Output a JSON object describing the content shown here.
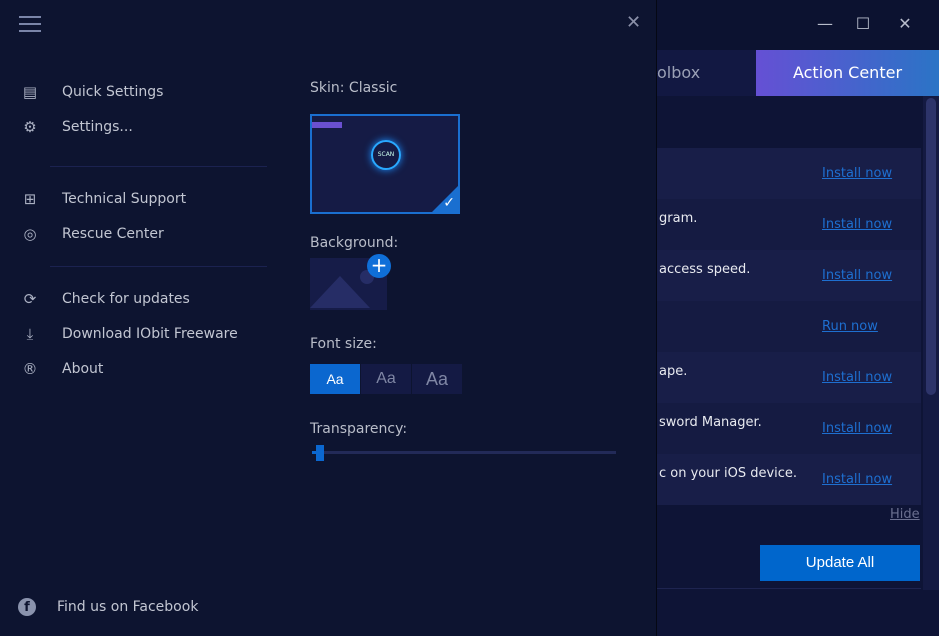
{
  "background_window": {
    "tabs": [
      {
        "label": "olbox"
      },
      {
        "label": "Action Center",
        "active": true
      }
    ],
    "rows": [
      {
        "text": "",
        "action": "Install now"
      },
      {
        "text": "gram.",
        "action": "Install now"
      },
      {
        "text": "access speed.",
        "action": "Install now"
      },
      {
        "text": "",
        "action": "Run now"
      },
      {
        "text": "ape.",
        "action": "Install now"
      },
      {
        "text": "sword Manager.",
        "action": "Install now"
      },
      {
        "text": "c on your iOS device.",
        "action": "Install now"
      }
    ],
    "hide_label": "Hide",
    "update_all_label": "Update All",
    "window_controls": {
      "minimize": "—",
      "maximize": "☐",
      "close": "✕"
    }
  },
  "menu": {
    "close_glyph": "✕",
    "groups": [
      [
        {
          "label": "Quick Settings",
          "icon": "toggle-icon"
        },
        {
          "label": "Settings...",
          "icon": "gear-icon"
        }
      ],
      [
        {
          "label": "Technical Support",
          "icon": "support-icon"
        },
        {
          "label": "Rescue Center",
          "icon": "lifebuoy-icon"
        }
      ],
      [
        {
          "label": "Check for updates",
          "icon": "refresh-icon"
        },
        {
          "label": "Download IObit Freeware",
          "icon": "download-icon"
        },
        {
          "label": "About",
          "icon": "registered-icon"
        }
      ]
    ],
    "facebook_label": "Find us on Facebook"
  },
  "settings": {
    "skin_label": "Skin: Classic",
    "skin_scan": "SCAN",
    "background_label": "Background:",
    "font_size_label": "Font size:",
    "font_sizes": [
      {
        "label": "Aa",
        "selected": true
      },
      {
        "label": "Aa"
      },
      {
        "label": "Aa"
      }
    ],
    "transparency_label": "Transparency:",
    "transparency_percent": 2
  },
  "colors": {
    "accent": "#0b67cf",
    "link": "#1e6fd0",
    "panel": "#0d1430"
  }
}
